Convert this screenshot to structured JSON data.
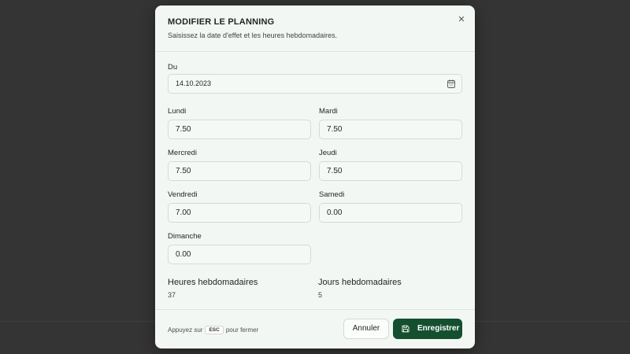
{
  "dialog": {
    "title": "MODIFIER LE PLANNING",
    "subtitle": "Saisissez la date d'effet et les heures hebdomadaires."
  },
  "date": {
    "label": "Du",
    "value": "14.10.2023"
  },
  "days": {
    "monday": {
      "label": "Lundi",
      "value": "7.50"
    },
    "tuesday": {
      "label": "Mardi",
      "value": "7.50"
    },
    "wednesday": {
      "label": "Mercredi",
      "value": "7.50"
    },
    "thursday": {
      "label": "Jeudi",
      "value": "7.50"
    },
    "friday": {
      "label": "Vendredi",
      "value": "7.00"
    },
    "saturday": {
      "label": "Samedi",
      "value": "0.00"
    },
    "sunday": {
      "label": "Dimanche",
      "value": "0.00"
    }
  },
  "summary": {
    "hours_label": "Heures hebdomadaires",
    "hours_value": "37",
    "days_label": "Jours hebdomadaires",
    "days_value": "5"
  },
  "footer": {
    "hint_prefix": "Appuyez sur",
    "hint_key": "ESC",
    "hint_suffix": "pour fermer",
    "cancel_label": "Annuler",
    "save_label": "Enregistrer"
  },
  "colors": {
    "primary": "#14502f",
    "background": "#f3f7f3",
    "backdrop": "#333433"
  }
}
